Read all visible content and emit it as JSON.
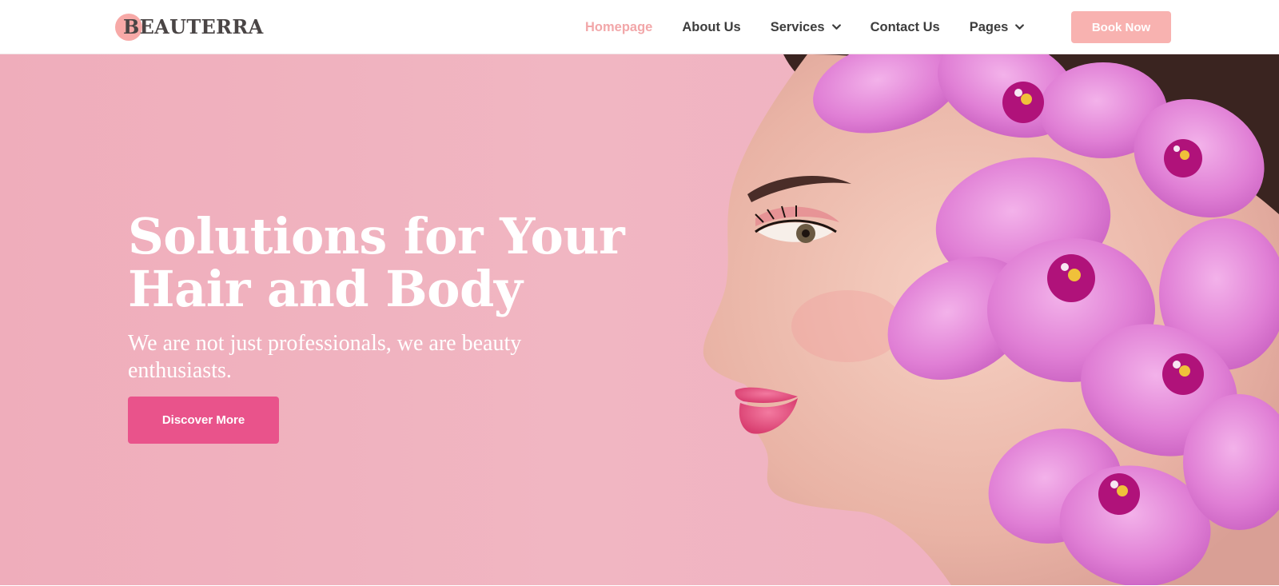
{
  "brand": {
    "name": "BEAUTERRA"
  },
  "nav": {
    "items": [
      {
        "label": "Homepage",
        "active": true,
        "dropdown": false
      },
      {
        "label": "About Us",
        "active": false,
        "dropdown": false
      },
      {
        "label": "Services",
        "active": false,
        "dropdown": true
      },
      {
        "label": "Contact Us",
        "active": false,
        "dropdown": false
      },
      {
        "label": "Pages",
        "active": false,
        "dropdown": true
      }
    ],
    "cta_label": "Book Now"
  },
  "hero": {
    "title": "Solutions for Your Hair and Body",
    "subtitle": "We are not just professionals, we are beauty enthusiasts.",
    "button_label": "Discover More",
    "image_icon": "woman-with-orchids-illustration"
  },
  "colors": {
    "accent": "#f2a7a9",
    "cta": "#f8b2b0",
    "button": "#e9538b",
    "hero_bg": "#f1b6c2"
  }
}
